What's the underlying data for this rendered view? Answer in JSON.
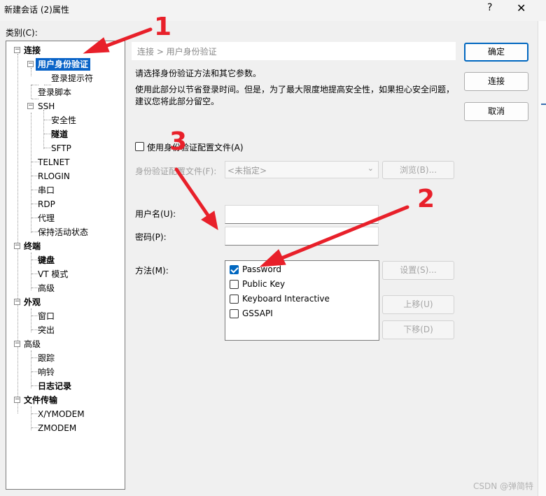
{
  "window": {
    "title": "新建会话 (2)属性",
    "help": "?",
    "close": "✕"
  },
  "category_label": "类别(C):",
  "tree": {
    "lian_jie": "连接",
    "yong_hu": "用户身份验证",
    "deng_lu_ti_shi": "登录提示符",
    "deng_lu_jiao_ben": "登录脚本",
    "ssh": "SSH",
    "an_quan_xing": "安全性",
    "sui_dao": "隧道",
    "sftp": "SFTP",
    "telnet": "TELNET",
    "rlogin": "RLOGIN",
    "chuan_kou": "串口",
    "rdp": "RDP",
    "dai_li": "代理",
    "bao_chi": "保持活动状态",
    "zhong_duan": "终端",
    "jian_pan": "键盘",
    "vt": "VT 模式",
    "gao_ji_1": "高级",
    "wai_guan": "外观",
    "chuang_kou": "窗口",
    "tu_chu": "突出",
    "gao_ji_2": "高级",
    "gen_zong": "跟踪",
    "xiang_ling": "响铃",
    "ri_zhi": "日志记录",
    "wen_jian": "文件传输",
    "xymodem": "X/YMODEM",
    "zmodem": "ZMODEM",
    "expander_minus": "−"
  },
  "panel": {
    "breadcrumb": "连接 > 用户身份验证",
    "desc1": "请选择身份验证方法和其它参数。",
    "desc2": "使用此部分以节省登录时间。但是，为了最大限度地提高安全性，如果担心安全问题，",
    "desc3": "建议您将此部分留空。",
    "use_profile": "使用身份验证配置文件(A)",
    "profile_label": "身份验证配置文件(F):",
    "profile_value": "<未指定>",
    "browse": "浏览(B)...",
    "username_label": "用户名(U):",
    "username_value": "",
    "password_label": "密码(P):",
    "password_value": "",
    "method_label": "方法(M):",
    "methods": [
      "Password",
      "Public Key",
      "Keyboard Interactive",
      "GSSAPI"
    ],
    "settings": "设置(S)...",
    "move_up": "上移(U)",
    "move_down": "下移(D)"
  },
  "buttons": {
    "ok": "确定",
    "connect": "连接",
    "cancel": "取消"
  },
  "annotations": {
    "n1": "1",
    "n2": "2",
    "n3": "3"
  },
  "watermark": "CSDN @弹简特",
  "colors": {
    "selection": "#0a64c8",
    "accent": "#0067c0",
    "annotation": "#e8202a"
  }
}
